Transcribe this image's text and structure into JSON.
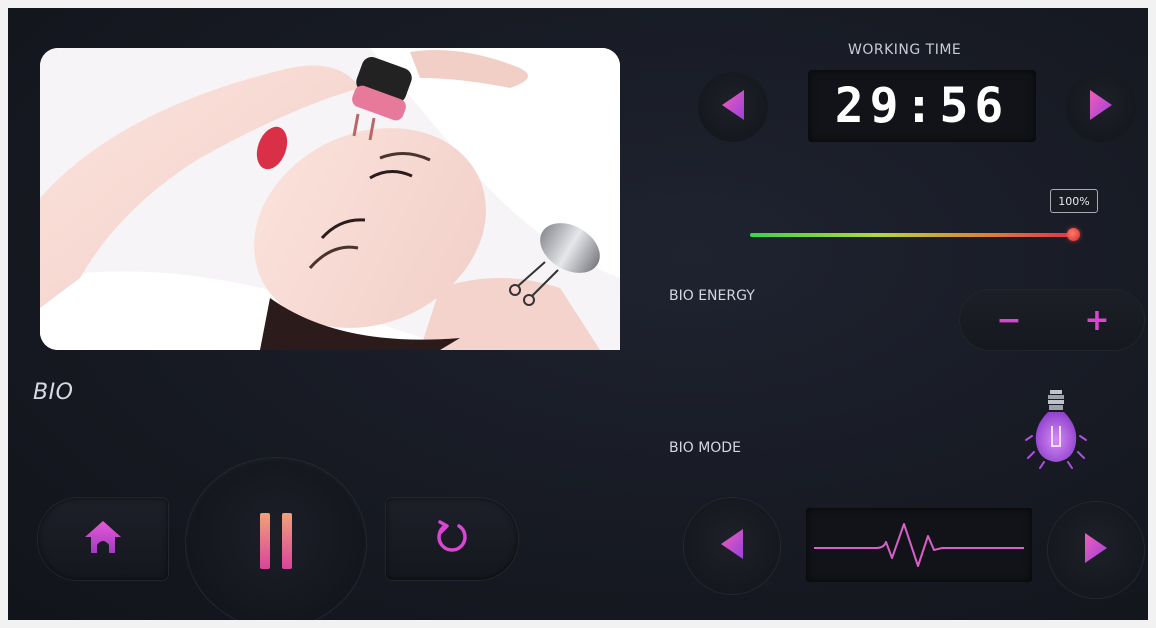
{
  "mode": {
    "title": "BIO"
  },
  "timer": {
    "label": "WORKING TIME",
    "value": "29:56"
  },
  "energy": {
    "label": "BIO ENERGY",
    "level_text": "100%",
    "level_percent": 100,
    "minus_label": "−",
    "plus_label": "+"
  },
  "bio_mode": {
    "label": "BIO MODE",
    "indicator_icon": "light-bulb-icon",
    "pattern_icon": "heartbeat-wave-icon"
  },
  "controls": {
    "home_icon": "home-icon",
    "pause_icon": "pause-icon",
    "reset_icon": "refresh-icon"
  },
  "colors": {
    "accent": "#d946d0",
    "arrow": "#c84fe3",
    "text": "#d4d7e0"
  }
}
